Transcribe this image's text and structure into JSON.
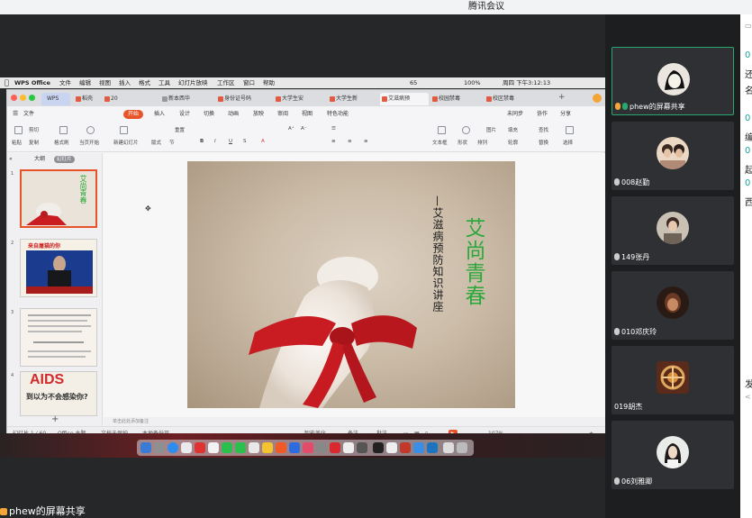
{
  "meeting": {
    "title": "腾讯会议",
    "sharer_label": "phew的屏幕共享"
  },
  "mac_menubar": {
    "items": [
      "WPS Office",
      "文件",
      "编辑",
      "视图",
      "插入",
      "格式",
      "工具",
      "幻灯片放映",
      "工作区",
      "窗口",
      "帮助"
    ],
    "status_right": "65",
    "battery": "100%",
    "clock": "周四 下午3:12:13"
  },
  "wps": {
    "tabs": [
      {
        "label": "WPS",
        "kind": "home"
      },
      {
        "label": "稻壳",
        "kind": "red"
      },
      {
        "label": "20",
        "kind": "red"
      },
      {
        "label": "新本西华",
        "kind": "gray"
      },
      {
        "label": "身份证号码",
        "kind": "red"
      },
      {
        "label": "大学生安",
        "kind": "red"
      },
      {
        "label": "大学生新",
        "kind": "red"
      },
      {
        "label": "艾滋病预",
        "kind": "red",
        "active": true
      },
      {
        "label": "校园禁毒",
        "kind": "red"
      },
      {
        "label": "校区禁毒",
        "kind": "red"
      }
    ],
    "menu": [
      "文件",
      "开始",
      "插入",
      "设计",
      "切换",
      "动画",
      "放映",
      "审阅",
      "视图",
      "特色功能"
    ],
    "menu_right": [
      "未同步",
      "协作",
      "分享"
    ],
    "ribbon": [
      "剪切",
      "复制",
      "粘贴",
      "格式刷",
      "当页开始",
      "新建幻灯片",
      "版式",
      "节",
      "重置",
      "文本框",
      "形状",
      "排列",
      "图片",
      "填充",
      "轮廓",
      "查找",
      "替换",
      "选择"
    ],
    "sidebar_tabs": {
      "outline": "大纲",
      "slides": "幻灯片"
    },
    "thumbnails": [
      {
        "num": "1",
        "label": "艾尚青春"
      },
      {
        "num": "2",
        "label": "来自屠猫的你"
      },
      {
        "num": "3",
        "label": ""
      },
      {
        "num": "4",
        "label": "AIDS",
        "sub": "到以为不会感染你?"
      }
    ],
    "slide": {
      "title_green": "艾尚青春",
      "subtitle_black": "—艾滋病预防知识讲座"
    },
    "note_placeholder": "单击此处添加备注",
    "status": {
      "slide_pos": "幻灯片 1 / 60",
      "theme": "Office 主题",
      "protect": "文档未保护",
      "backup": "本地备份开",
      "beautify": "智能美化",
      "notes": "备注",
      "comments": "批注",
      "zoom": "107%"
    }
  },
  "participants": [
    {
      "name": "phew的屏幕共享",
      "active": true,
      "avatar": "sketch"
    },
    {
      "name": "008赵勤",
      "avatar": "couple"
    },
    {
      "name": "149张丹",
      "avatar": "person"
    },
    {
      "name": "010邓庆玲",
      "avatar": "dark"
    },
    {
      "name": "019胡杰",
      "avatar": "pattern"
    },
    {
      "name": "06刘雅卿",
      "avatar": "girl"
    }
  ],
  "chat_edge": [
    "0",
    "还",
    "名",
    "0",
    "编",
    "0",
    "起",
    "0",
    "西",
    "发",
    "<"
  ]
}
